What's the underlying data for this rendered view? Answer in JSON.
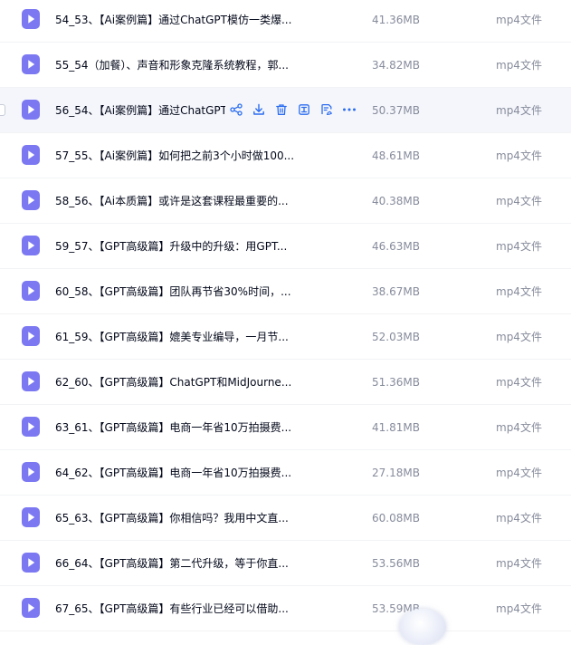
{
  "files": [
    {
      "name": "54_53、【Ai案例篇】通过ChatGPT模仿一类爆...",
      "size": "41.36MB",
      "type": "mp4文件"
    },
    {
      "name": "55_54（加餐）、声音和形象克隆系统教程，郭...",
      "size": "34.82MB",
      "type": "mp4文件"
    },
    {
      "name": "56_54、【Ai案例篇】通过ChatGPT",
      "size": "50.37MB",
      "type": "mp4文件"
    },
    {
      "name": "57_55、【Ai案例篇】如何把之前3个小时做100...",
      "size": "48.61MB",
      "type": "mp4文件"
    },
    {
      "name": "58_56、【Ai本质篇】或许是这套课程最重要的...",
      "size": "40.38MB",
      "type": "mp4文件"
    },
    {
      "name": "59_57、【GPT高级篇】升级中的升级：用GPT...",
      "size": "46.63MB",
      "type": "mp4文件"
    },
    {
      "name": "60_58、【GPT高级篇】团队再节省30%时间，...",
      "size": "38.67MB",
      "type": "mp4文件"
    },
    {
      "name": "61_59、【GPT高级篇】媲美专业编导，一月节...",
      "size": "52.03MB",
      "type": "mp4文件"
    },
    {
      "name": "62_60、【GPT高级篇】ChatGPT和MidJourne...",
      "size": "51.36MB",
      "type": "mp4文件"
    },
    {
      "name": "63_61、【GPT高级篇】电商一年省10万拍摄费...",
      "size": "41.81MB",
      "type": "mp4文件"
    },
    {
      "name": "64_62、【GPT高级篇】电商一年省10万拍摄费...",
      "size": "27.18MB",
      "type": "mp4文件"
    },
    {
      "name": "65_63、【GPT高级篇】你相信吗？我用中文直...",
      "size": "60.08MB",
      "type": "mp4文件"
    },
    {
      "name": "66_64、【GPT高级篇】第二代升级，等于你直...",
      "size": "53.56MB",
      "type": "mp4文件"
    },
    {
      "name": "67_65、【GPT高级篇】有些行业已经可以借助...",
      "size": "53.59MB",
      "type": "mp4文件"
    }
  ],
  "hovered_row": 2,
  "row_actions": [
    "share-icon",
    "download-icon",
    "delete-icon",
    "extract-icon",
    "rename-icon",
    "more-icon"
  ],
  "colors": {
    "icon_purple": "#7b78f2",
    "action_blue": "#2b6cf0",
    "text_primary": "#03081a",
    "text_secondary": "#878c9c",
    "hover_background": "#f4f6fb"
  }
}
